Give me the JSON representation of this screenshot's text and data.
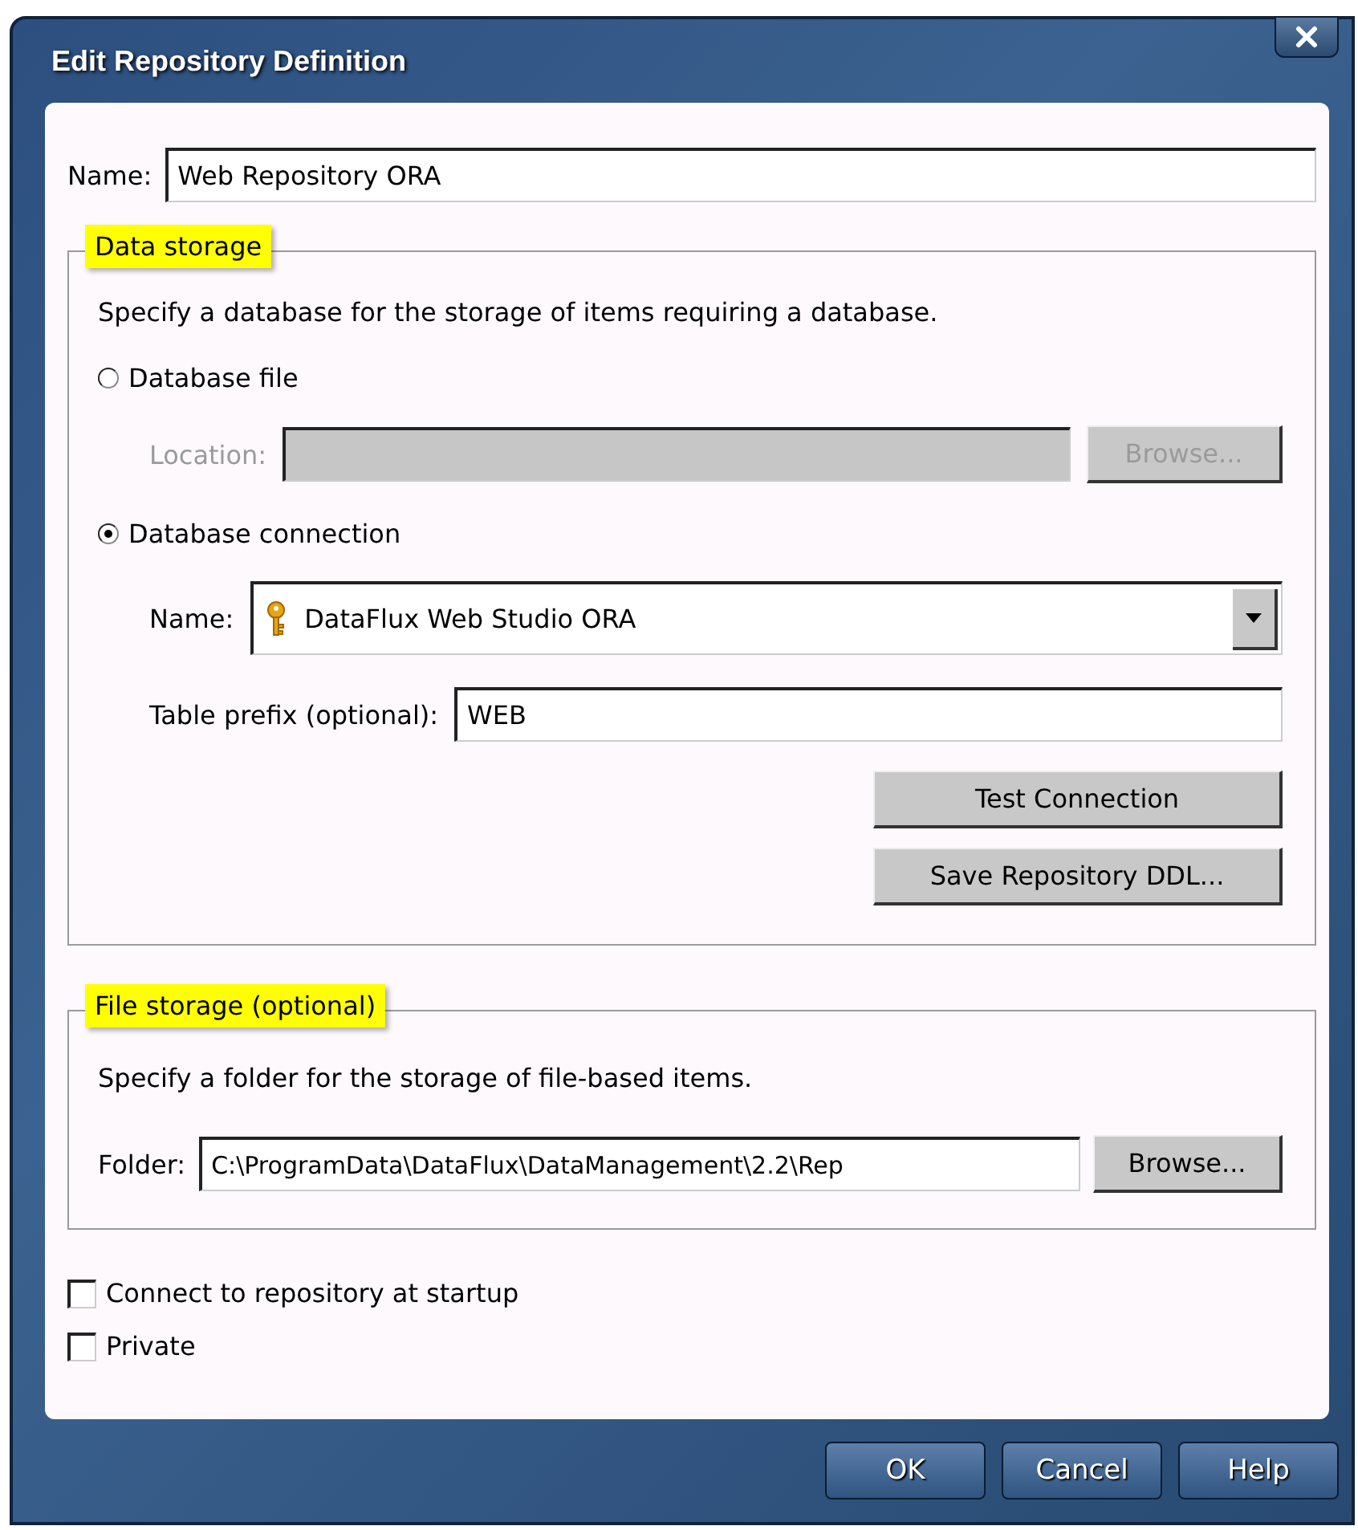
{
  "window": {
    "title": "Edit Repository Definition"
  },
  "name_field": {
    "label": "Name:",
    "value": "Web Repository ORA"
  },
  "data_storage": {
    "legend": "Data storage",
    "highlighted": true,
    "description": "Specify a database for the storage of items requiring a database.",
    "options": [
      {
        "label": "Database file",
        "selected": false
      },
      {
        "label": "Database connection",
        "selected": true
      }
    ],
    "location": {
      "label": "Location:",
      "disabled": true
    },
    "location_browse": {
      "label": "Browse...",
      "disabled": true
    },
    "connection": {
      "label": "Name:",
      "value": "DataFlux Web Studio ORA"
    },
    "table_prefix": {
      "label": "Table prefix (optional):",
      "value": "WEB"
    },
    "buttons": [
      "Test Connection",
      "Save Repository DDL..."
    ]
  },
  "file_storage": {
    "legend": "File storage (optional)",
    "highlighted": true,
    "description": "Specify a folder for the storage of file-based items.",
    "folder": {
      "label": "Folder:",
      "value": "C:\\ProgramData\\DataFlux\\DataManagement\\2.2\\Rep"
    },
    "browse": {
      "label": "Browse...",
      "disabled": false
    }
  },
  "checkboxes": [
    {
      "label": "Connect to repository at startup",
      "checked": false
    },
    {
      "label": "Private",
      "checked": false
    }
  ],
  "buttons": [
    "OK",
    "Cancel",
    "Help"
  ]
}
